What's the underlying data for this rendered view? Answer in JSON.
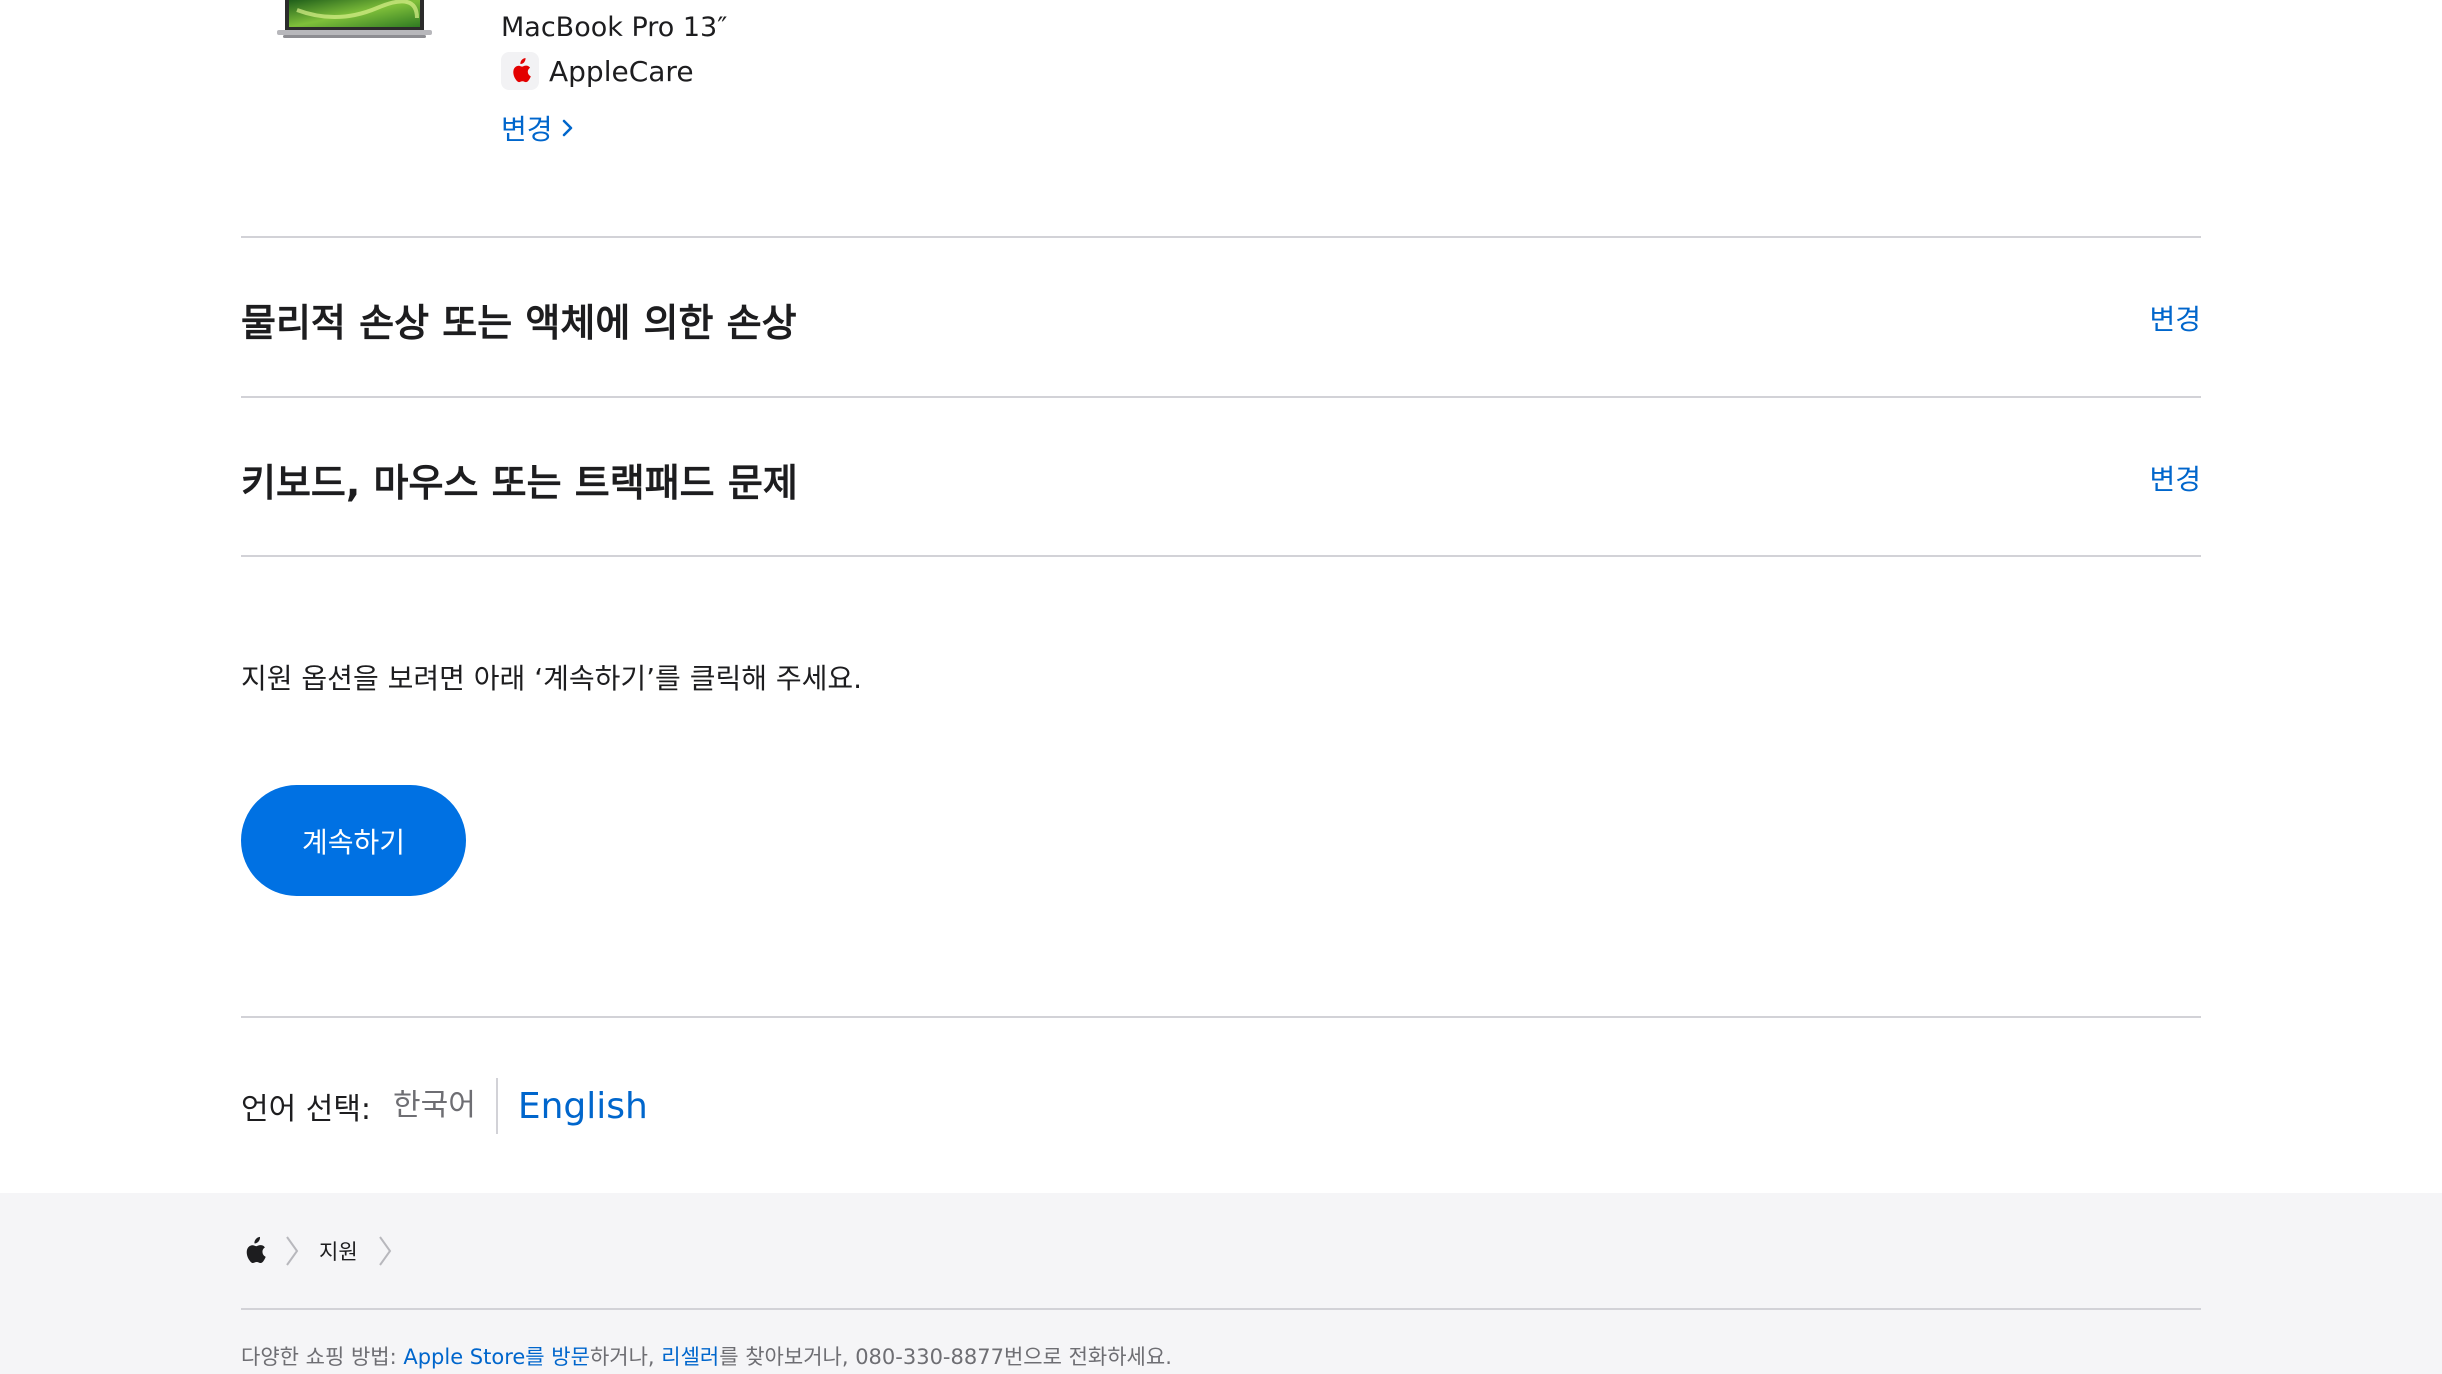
{
  "product": {
    "name": "MacBook Pro 13″",
    "coverage": "AppleCare",
    "change_label": "변경"
  },
  "issues": [
    {
      "title": "물리적 손상 또는 액체에 의한 손상",
      "change_label": "변경"
    },
    {
      "title": "키보드, 마우스 또는 트랙패드 문제",
      "change_label": "변경"
    }
  ],
  "instruction": "지원 옵션을 보려면 아래 ‘계속하기’를 클릭해 주세요.",
  "continue_button": "계속하기",
  "language": {
    "label": "언어 선택:",
    "current": "한국어",
    "alternate": "English"
  },
  "footer": {
    "breadcrumb": [
      "지원"
    ],
    "note": {
      "prefix": "다양한 쇼핑 방법: ",
      "store_link": "Apple Store를 방문",
      "mid1": "하거나, ",
      "reseller_link": "리셀러",
      "mid2": "를 찾아보거나, ",
      "phone": "080-330-8877",
      "suffix": "번으로 전화하세요."
    }
  },
  "colors": {
    "link": "#0066cc",
    "button": "#0071e3",
    "divider": "#d2d2d7",
    "footer_bg": "#f5f5f7",
    "applecare_red": "#e30000"
  },
  "icons": {
    "applecare": "apple-logo-red-icon",
    "chevron": "chevron-right-icon",
    "apple": "apple-logo-icon"
  }
}
